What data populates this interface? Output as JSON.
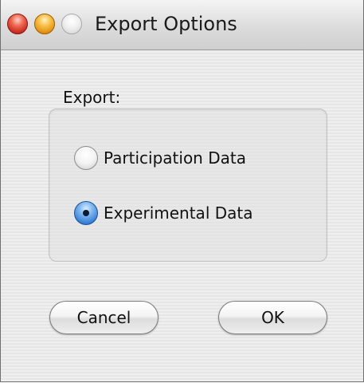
{
  "window": {
    "title": "Export Options"
  },
  "export_group": {
    "label": "Export:",
    "options": [
      {
        "label": "Participation Data",
        "selected": false
      },
      {
        "label": "Experimental Data",
        "selected": true
      }
    ]
  },
  "buttons": {
    "cancel_label": "Cancel",
    "ok_label": "OK"
  },
  "colors": {
    "close": "#e0443a",
    "minimize": "#f2a52a",
    "radio_selected": "#2f78d4"
  }
}
